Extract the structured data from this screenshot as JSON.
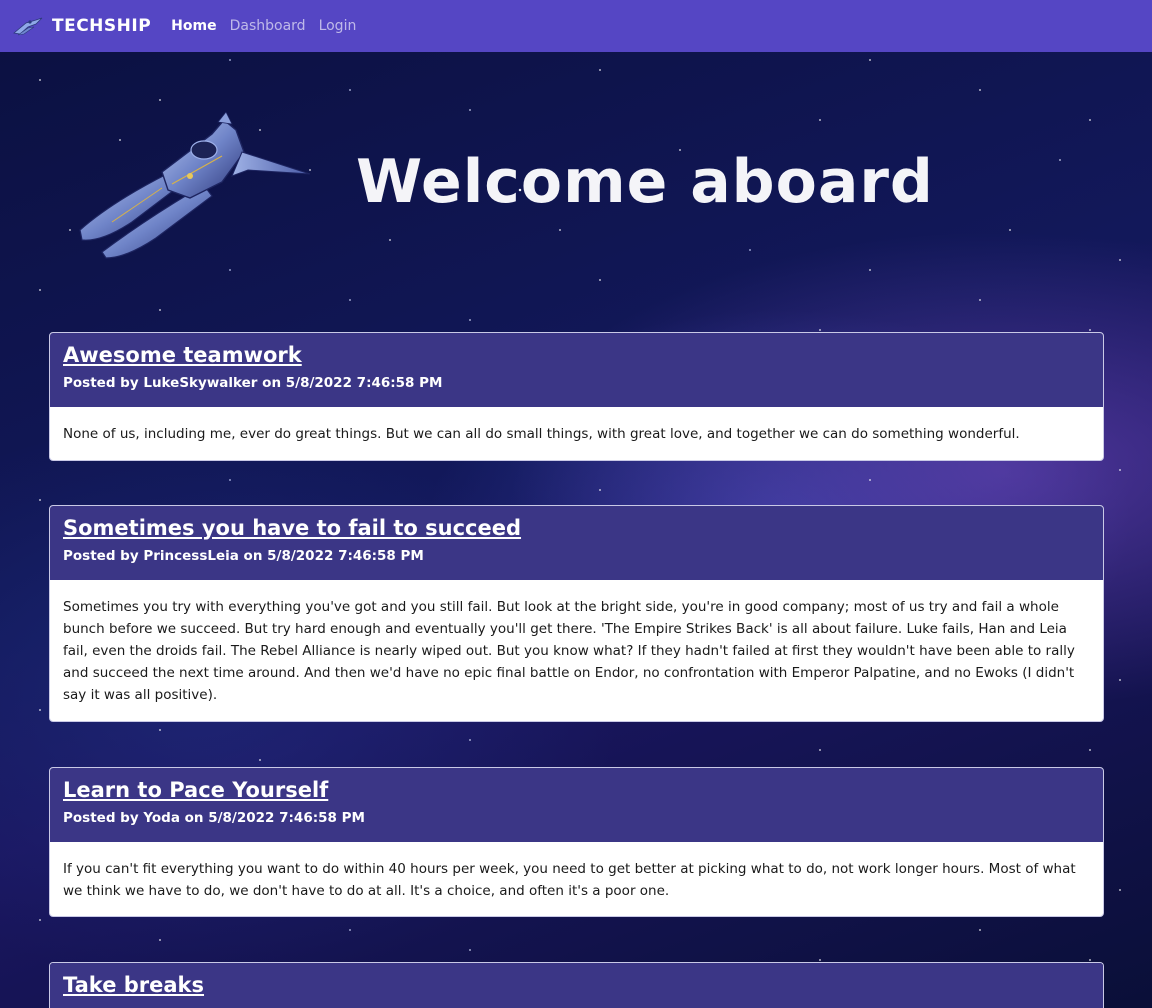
{
  "nav": {
    "brand": "TECHSHIP",
    "links": [
      {
        "label": "Home",
        "active": true
      },
      {
        "label": "Dashboard",
        "active": false
      },
      {
        "label": "Login",
        "active": false
      }
    ]
  },
  "hero": {
    "title": "Welcome aboard"
  },
  "posts": [
    {
      "title": "Awesome teamwork",
      "meta": "Posted by LukeSkywalker on 5/8/2022 7:46:58 PM",
      "body": "None of us, including me, ever do great things. But we can all do small things, with great love, and together we can do something wonderful."
    },
    {
      "title": "Sometimes you have to fail to succeed",
      "meta": "Posted by PrincessLeia on 5/8/2022 7:46:58 PM",
      "body": "Sometimes you try with everything you've got and you still fail. But look at the bright side, you're in good company; most of us try and fail a whole bunch before we succeed. But try hard enough and eventually you'll get there. 'The Empire Strikes Back' is all about failure. Luke fails, Han and Leia fail, even the droids fail. The Rebel Alliance is nearly wiped out. But you know what? If they hadn't failed at first they wouldn't have been able to rally and succeed the next time around. And then we'd have no epic final battle on Endor, no confrontation with Emperor Palpatine, and no Ewoks (I didn't say it was all positive)."
    },
    {
      "title": "Learn to Pace Yourself",
      "meta": "Posted by Yoda on 5/8/2022 7:46:58 PM",
      "body": "If you can't fit everything you want to do within 40 hours per week, you need to get better at picking what to do, not work longer hours. Most of what we think we have to do, we don't have to do at all. It's a choice, and often it's a poor one."
    },
    {
      "title": "Take breaks",
      "meta": "",
      "body": ""
    }
  ],
  "colors": {
    "navbar": "#5546c4",
    "card_header": "#3b3686",
    "card_body": "#ffffff"
  },
  "icons": {
    "brand_logo": "spaceship-icon",
    "hero_image": "spaceship-illustration"
  }
}
